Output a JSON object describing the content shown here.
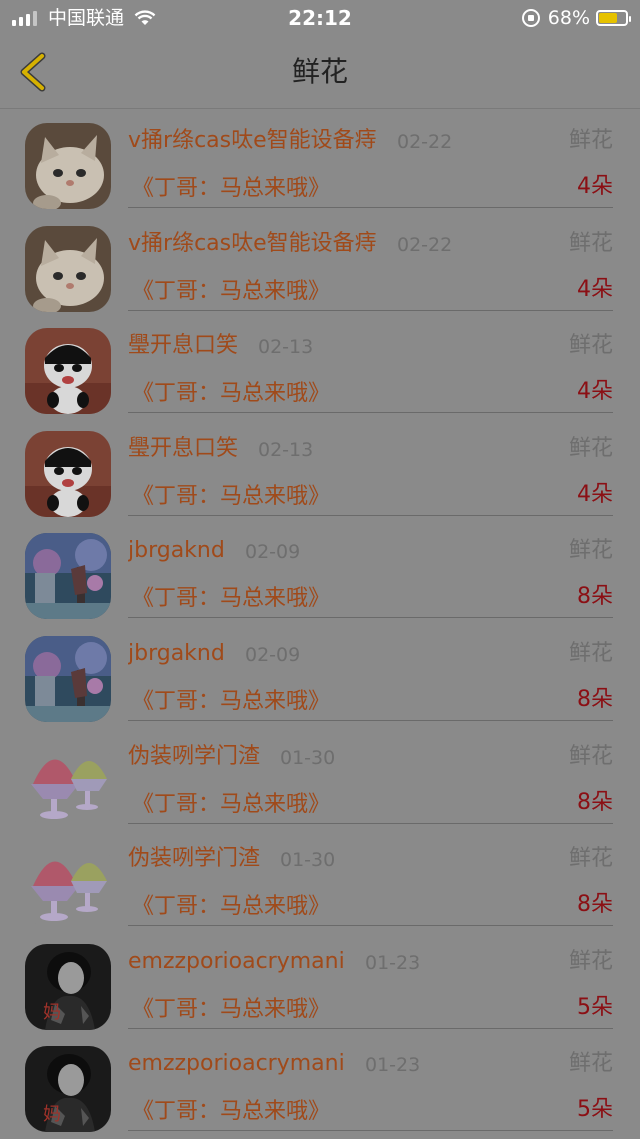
{
  "status_bar": {
    "carrier": "中国联通",
    "time": "22:12",
    "battery": "68%",
    "battery_level": 0.68,
    "icons": [
      "signal-icon",
      "wifi-icon",
      "rotation-lock-icon",
      "battery-icon"
    ]
  },
  "nav": {
    "back_icon": "chevron-left-icon",
    "title": "鲜花",
    "accent": "#d6b100"
  },
  "colors": {
    "name": "#a04a1a",
    "date": "#6e6e6e",
    "count": "#8b0f14"
  },
  "gifts": [
    {
      "avatar": "kitten-avatar",
      "name": "v捅r绦cas呔e智能设备痔",
      "date": "02-22",
      "type": "鲜花",
      "message": "《丁哥：马总来哦》",
      "count": "4朵"
    },
    {
      "avatar": "kitten-avatar",
      "name": "v捅r绦cas呔e智能设备痔",
      "date": "02-22",
      "type": "鲜花",
      "message": "《丁哥：马总来哦》",
      "count": "4朵"
    },
    {
      "avatar": "panda-avatar",
      "name": "璺开息口笑",
      "date": "02-13",
      "type": "鲜花",
      "message": "《丁哥：马总来哦》",
      "count": "4朵"
    },
    {
      "avatar": "panda-avatar",
      "name": "璺开息口笑",
      "date": "02-13",
      "type": "鲜花",
      "message": "《丁哥：马总来哦》",
      "count": "4朵"
    },
    {
      "avatar": "anime-avatar",
      "name": "jbrgaknd",
      "date": "02-09",
      "type": "鲜花",
      "message": "《丁哥：马总来哦》",
      "count": "8朵"
    },
    {
      "avatar": "anime-avatar",
      "name": "jbrgaknd",
      "date": "02-09",
      "type": "鲜花",
      "message": "《丁哥：马总来哦》",
      "count": "8朵"
    },
    {
      "avatar": "ice-cream-avatar",
      "name": "伪装咧学门渣",
      "date": "01-30",
      "type": "鲜花",
      "message": "《丁哥：马总来哦》",
      "count": "8朵"
    },
    {
      "avatar": "ice-cream-avatar",
      "name": "伪装咧学门渣",
      "date": "01-30",
      "type": "鲜花",
      "message": "《丁哥：马总来哦》",
      "count": "8朵"
    },
    {
      "avatar": "portrait-avatar",
      "name": "emzzporioacrymani",
      "date": "01-23",
      "type": "鲜花",
      "message": "《丁哥：马总来哦》",
      "count": "5朵"
    },
    {
      "avatar": "portrait-avatar",
      "name": "emzzporioacrymani",
      "date": "01-23",
      "type": "鲜花",
      "message": "《丁哥：马总来哦》",
      "count": "5朵"
    }
  ]
}
